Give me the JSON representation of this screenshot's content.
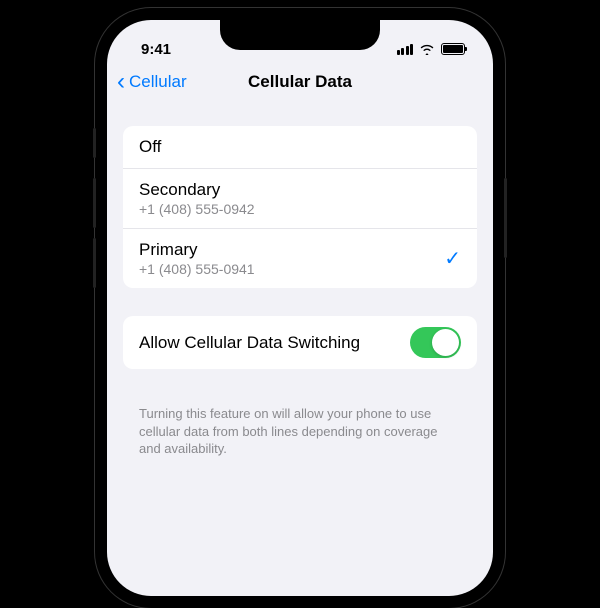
{
  "statusBar": {
    "time": "9:41"
  },
  "nav": {
    "back": "Cellular",
    "title": "Cellular Data"
  },
  "selection": {
    "off": "Off",
    "secondary": {
      "label": "Secondary",
      "number": "+1 (408) 555-0942"
    },
    "primary": {
      "label": "Primary",
      "number": "+1 (408) 555-0941"
    }
  },
  "switching": {
    "label": "Allow Cellular Data Switching",
    "footer": "Turning this feature on will allow your phone to use cellular data from both lines depending on coverage and availability."
  }
}
